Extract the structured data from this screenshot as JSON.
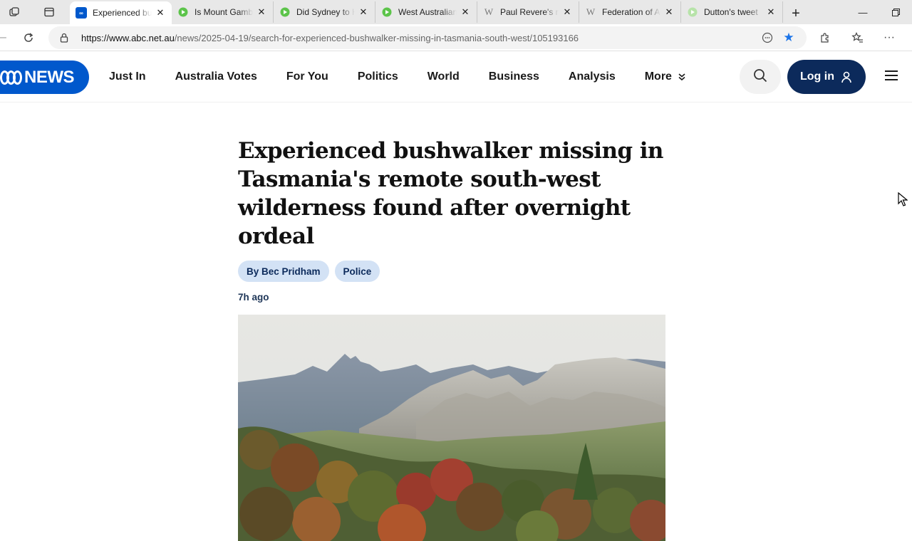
{
  "browser": {
    "tabs": [
      {
        "title": "Experienced bushwalker",
        "favicon": "abc-icon",
        "active": true
      },
      {
        "title": "Is Mount Gambier",
        "favicon": "play-icon",
        "active": false
      },
      {
        "title": "Did Sydney to H",
        "favicon": "play-icon",
        "active": false
      },
      {
        "title": "West Australian",
        "favicon": "play-icon",
        "active": false
      },
      {
        "title": "Paul Revere's m",
        "favicon": "wiki-icon",
        "active": false
      },
      {
        "title": "Federation of A",
        "favicon": "wiki-icon",
        "active": false
      },
      {
        "title": "Dutton's tweet",
        "favicon": "play-icon",
        "active": false
      }
    ],
    "url_host": "https://www.abc.net.au",
    "url_path": "/news/2025-04-19/search-for-experienced-bushwalker-missing-in-tasmania-south-west/105193166"
  },
  "header": {
    "logo_text": "NEWS",
    "nav": [
      "Just In",
      "Australia Votes",
      "For You",
      "Politics",
      "World",
      "Business",
      "Analysis",
      "More"
    ],
    "login_label": "Log in"
  },
  "article": {
    "headline": "Experienced bushwalker missing in Tasmania's remote south-west wilderness found after overnight ordeal",
    "byline": "By Bec Pridham",
    "topic": "Police",
    "timestamp": "7h ago"
  },
  "colors": {
    "brand": "#0058cc",
    "login_bg": "#0c2a5b",
    "tag_bg": "#d3e2f5"
  }
}
